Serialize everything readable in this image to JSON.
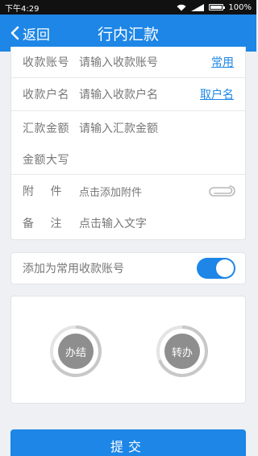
{
  "status_bar": {
    "time": "下午4:29",
    "battery": "100%",
    "battery_level": 1.0
  },
  "header": {
    "back_label": "返回",
    "title": "行内汇款"
  },
  "form": {
    "account": {
      "label": "收款账号",
      "placeholder": "请输入收款账号",
      "action": "常用"
    },
    "account_name": {
      "label": "收款户名",
      "placeholder": "请输入收款户名",
      "action": "取户名"
    },
    "amount": {
      "label": "汇款金额",
      "placeholder": "请输入汇款金额"
    },
    "amount_words": {
      "label": "金额大写",
      "value": ""
    },
    "attachment": {
      "label": "附 件",
      "placeholder": "点击添加附件",
      "icon": "paperclip-icon"
    },
    "remark": {
      "label": "备 注",
      "placeholder": "点击输入文字"
    }
  },
  "save_toggle": {
    "label": "添加为常用收款账号",
    "on": true
  },
  "actions": [
    {
      "label": "办结"
    },
    {
      "label": "转办"
    }
  ],
  "submit": {
    "label": "提交"
  },
  "colors": {
    "primary": "#1d86e6",
    "background": "#eef0f3",
    "text_muted": "#777777"
  }
}
